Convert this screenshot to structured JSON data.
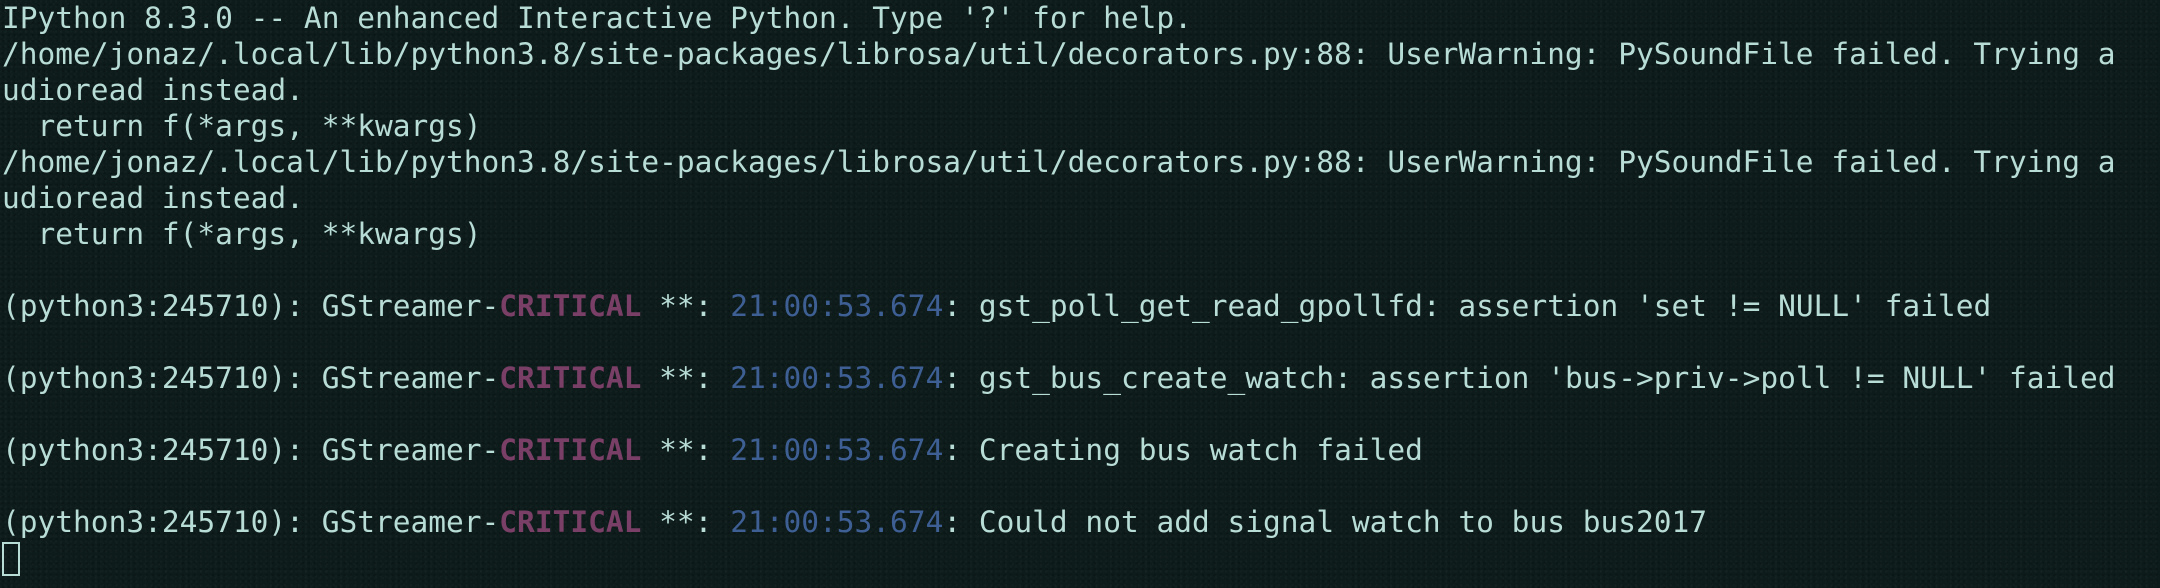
{
  "terminal": {
    "colors": {
      "background": "#0d1b1b",
      "text": "#b8dcd6",
      "critical": "#7a3f66",
      "timestamp": "#3d5f94"
    },
    "banner": "IPython 8.3.0 -- An enhanced Interactive Python. Type '?' for help.",
    "warnings": [
      {
        "line1": "/home/jonaz/.local/lib/python3.8/site-packages/librosa/util/decorators.py:88: UserWarning: PySoundFile failed. Trying a",
        "line2": "udioread instead.",
        "line3": "  return f(*args, **kwargs)"
      },
      {
        "line1": "/home/jonaz/.local/lib/python3.8/site-packages/librosa/util/decorators.py:88: UserWarning: PySoundFile failed. Trying a",
        "line2": "udioread instead.",
        "line3": "  return f(*args, **kwargs)"
      }
    ],
    "gst_messages": [
      {
        "prefix": "(python3:245710): GStreamer-",
        "level": "CRITICAL",
        "sep": " **: ",
        "timestamp": "21:00:53.674",
        "message": ": gst_poll_get_read_gpollfd: assertion 'set != NULL' failed"
      },
      {
        "prefix": "(python3:245710): GStreamer-",
        "level": "CRITICAL",
        "sep": " **: ",
        "timestamp": "21:00:53.674",
        "message": ": gst_bus_create_watch: assertion 'bus->priv->poll != NULL' failed"
      },
      {
        "prefix": "(python3:245710): GStreamer-",
        "level": "CRITICAL",
        "sep": " **: ",
        "timestamp": "21:00:53.674",
        "message": ": Creating bus watch failed"
      },
      {
        "prefix": "(python3:245710): GStreamer-",
        "level": "CRITICAL",
        "sep": " **: ",
        "timestamp": "21:00:53.674",
        "message": ": Could not add signal watch to bus bus2017"
      }
    ]
  }
}
